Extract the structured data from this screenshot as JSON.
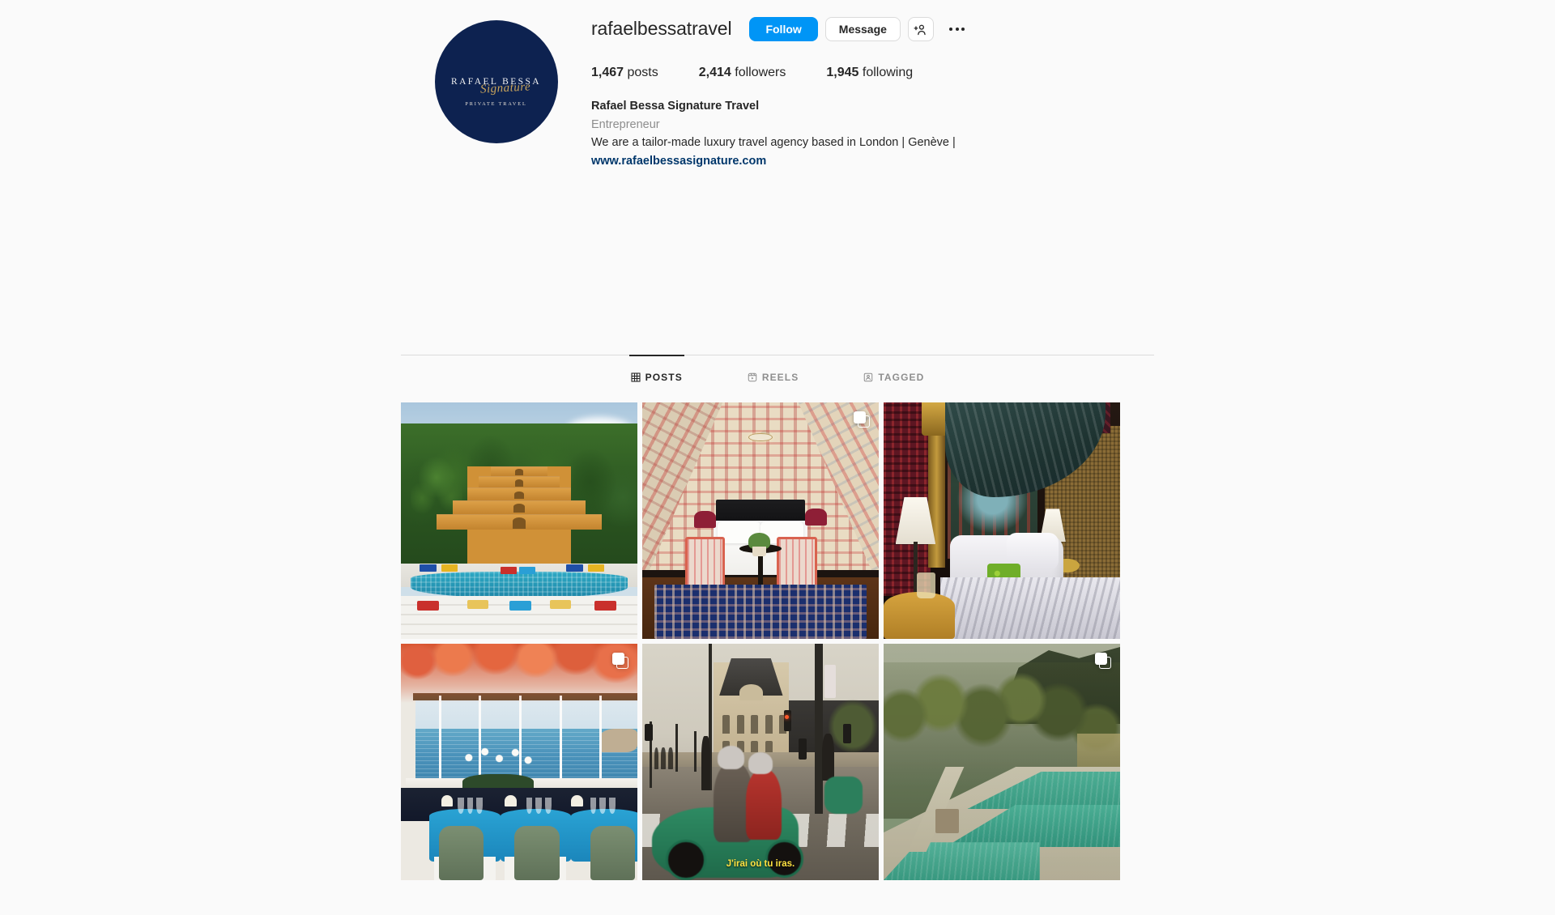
{
  "profile": {
    "username": "rafaelbessatravel",
    "avatar": {
      "brand_line": "RAFAEL BESSA",
      "script_line": "Signature",
      "sub_line": "PRIVATE TRAVEL",
      "background_color": "#0d2250",
      "accent_color": "#c8a45c"
    },
    "actions": {
      "follow_label": "Follow",
      "message_label": "Message",
      "add_person_icon": "person-add-icon",
      "more_options_icon": "more-options-icon",
      "follow_color": "#0095f6"
    },
    "stats": [
      {
        "value": "1,467",
        "label": "posts"
      },
      {
        "value": "2,414",
        "label": "followers"
      },
      {
        "value": "1,945",
        "label": "following"
      }
    ],
    "bio": {
      "full_name": "Rafael Bessa Signature Travel",
      "category": "Entrepreneur",
      "description": "We are a tailor-made luxury travel agency based in London | Genève |",
      "link": "www.rafaelbessasignature.com",
      "link_color": "#00376b"
    }
  },
  "tabs": [
    {
      "label": "POSTS",
      "icon": "grid-icon",
      "active": true
    },
    {
      "label": "REELS",
      "icon": "reels-icon",
      "active": false
    },
    {
      "label": "TAGGED",
      "icon": "tagged-icon",
      "active": false
    }
  ],
  "grid": {
    "posts": [
      {
        "id": "post-1",
        "alt": "Tropical resort with terraced ochre buildings in jungle above a turquoise pool with colorful loungers",
        "is_carousel": false,
        "caption": ""
      },
      {
        "id": "post-2",
        "alt": "Attic hotel suite with red and cream patterned wallpaper, black headboard, fringed armchairs and blue Persian rug",
        "is_carousel": true,
        "caption": ""
      },
      {
        "id": "post-3",
        "alt": "Exotic bedroom with carved wooden headboard, teal draped canopy, white linens and green pillow",
        "is_carousel": false,
        "caption": ""
      },
      {
        "id": "post-4",
        "alt": "Seaside restaurant under coral bougainvillea with blue tablecloths, orchids and sea view",
        "is_carousel": true,
        "caption": ""
      },
      {
        "id": "post-5",
        "alt": "Paris street scene with green scooter crossing in front of a Louvre pavilion",
        "is_carousel": false,
        "caption": "J'irai où tu iras."
      },
      {
        "id": "post-6",
        "alt": "Terraced turquoise pool on a Mediterranean hillside surrounded by olive trees",
        "is_carousel": true,
        "caption": ""
      }
    ]
  }
}
